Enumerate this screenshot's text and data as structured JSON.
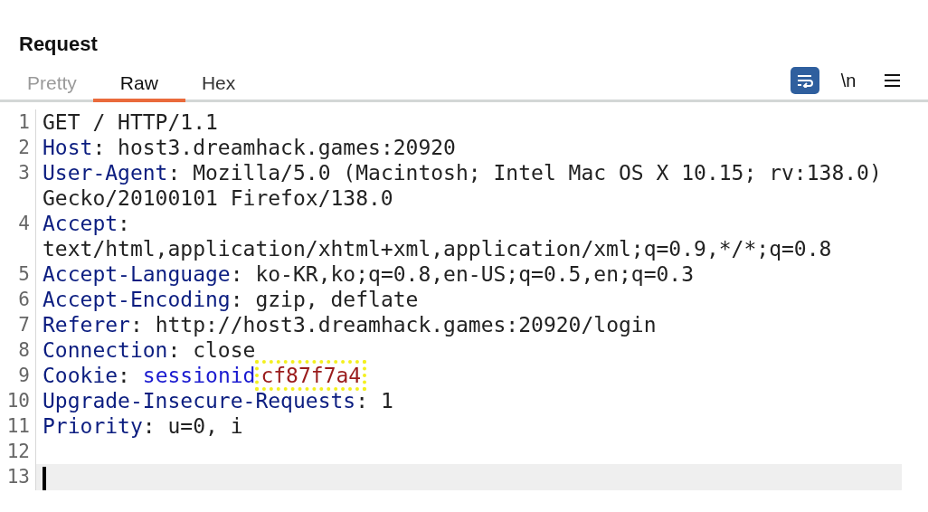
{
  "panel": {
    "title": "Request"
  },
  "tabs": [
    {
      "label": "Pretty",
      "selected": false,
      "disabled": true
    },
    {
      "label": "Raw",
      "selected": true,
      "disabled": false
    },
    {
      "label": "Hex",
      "selected": false,
      "disabled": false
    }
  ],
  "toolbar": [
    {
      "kind": "wrap",
      "selected": true
    },
    {
      "kind": "text",
      "label": "\\n",
      "selected": false
    },
    {
      "kind": "menu",
      "selected": false
    }
  ],
  "editor": {
    "lines": [
      {
        "number": "1",
        "current": false,
        "segments": [
          {
            "text": "GET / HTTP/1.1",
            "kind": "plain"
          }
        ]
      },
      {
        "number": "2",
        "current": false,
        "segments": [
          {
            "text": "Host",
            "kind": "header"
          },
          {
            "text": ": host3.dreamhack.games:20920",
            "kind": "plain"
          }
        ]
      },
      {
        "number": "3",
        "current": false,
        "segments": [
          {
            "text": "User-Agent",
            "kind": "header"
          },
          {
            "text": ": Mozilla/5.0 (Macintosh; Intel Mac OS X 10.15; rv:138.0) Gecko/20100101 Firefox/138.0",
            "kind": "plain"
          }
        ]
      },
      {
        "number": "4",
        "current": false,
        "segments": [
          {
            "text": "Accept",
            "kind": "header"
          },
          {
            "text": ": text/html,application/xhtml+xml,application/xml;q=0.9,*/*;q=0.8",
            "kind": "plain"
          }
        ]
      },
      {
        "number": "5",
        "current": false,
        "segments": [
          {
            "text": "Accept-Language",
            "kind": "header"
          },
          {
            "text": ": ko-KR,ko;q=0.8,en-US;q=0.5,en;q=0.3",
            "kind": "plain"
          }
        ]
      },
      {
        "number": "6",
        "current": false,
        "segments": [
          {
            "text": "Accept-Encoding",
            "kind": "header"
          },
          {
            "text": ": gzip, deflate",
            "kind": "plain"
          }
        ]
      },
      {
        "number": "7",
        "current": false,
        "segments": [
          {
            "text": "Referer",
            "kind": "header"
          },
          {
            "text": ": http://host3.dreamhack.games:20920/login",
            "kind": "plain"
          }
        ]
      },
      {
        "number": "8",
        "current": false,
        "segments": [
          {
            "text": "Connection",
            "kind": "header"
          },
          {
            "text": ": close",
            "kind": "plain"
          }
        ]
      },
      {
        "number": "9",
        "current": false,
        "segments": [
          {
            "text": "Cookie",
            "kind": "header"
          },
          {
            "text": ": ",
            "kind": "plain"
          },
          {
            "text": "sessionid",
            "kind": "cookie-name"
          },
          {
            "text": "cf87f7a4",
            "kind": "cookie-value",
            "highlighted": true
          }
        ]
      },
      {
        "number": "10",
        "current": false,
        "segments": [
          {
            "text": "Upgrade-Insecure-Requests",
            "kind": "header"
          },
          {
            "text": ": 1",
            "kind": "plain"
          }
        ]
      },
      {
        "number": "11",
        "current": false,
        "segments": [
          {
            "text": "Priority",
            "kind": "header"
          },
          {
            "text": ": u=0, i",
            "kind": "plain"
          }
        ]
      },
      {
        "number": "12",
        "current": false
      },
      {
        "number": "13",
        "current": true
      }
    ]
  }
}
